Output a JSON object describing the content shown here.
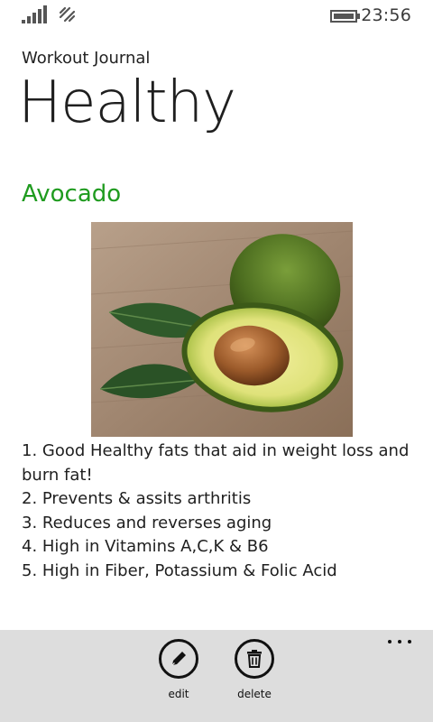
{
  "status_bar": {
    "time": "23:56",
    "signal_icon": "signal-strength-icon",
    "wifi_icon": "wifi-icon",
    "battery_icon": "battery-icon"
  },
  "header": {
    "app_name": "Workout Journal",
    "page_title": "Healthy"
  },
  "item": {
    "title": "Avocado",
    "title_color": "#1f9b1f",
    "image": "avocado-photo",
    "notes": [
      "1. Good Healthy fats that aid in weight loss and burn fat!",
      "2. Prevents & assits arthritis",
      "3. Reduces and reverses aging",
      "4. High in Vitamins A,C,K & B6",
      "5. High in Fiber, Potassium & Folic Acid"
    ]
  },
  "app_bar": {
    "background": "#dddddd",
    "buttons": [
      {
        "label": "edit",
        "icon": "pencil-icon"
      },
      {
        "label": "delete",
        "icon": "trash-icon"
      }
    ],
    "more_icon": "more-icon"
  }
}
